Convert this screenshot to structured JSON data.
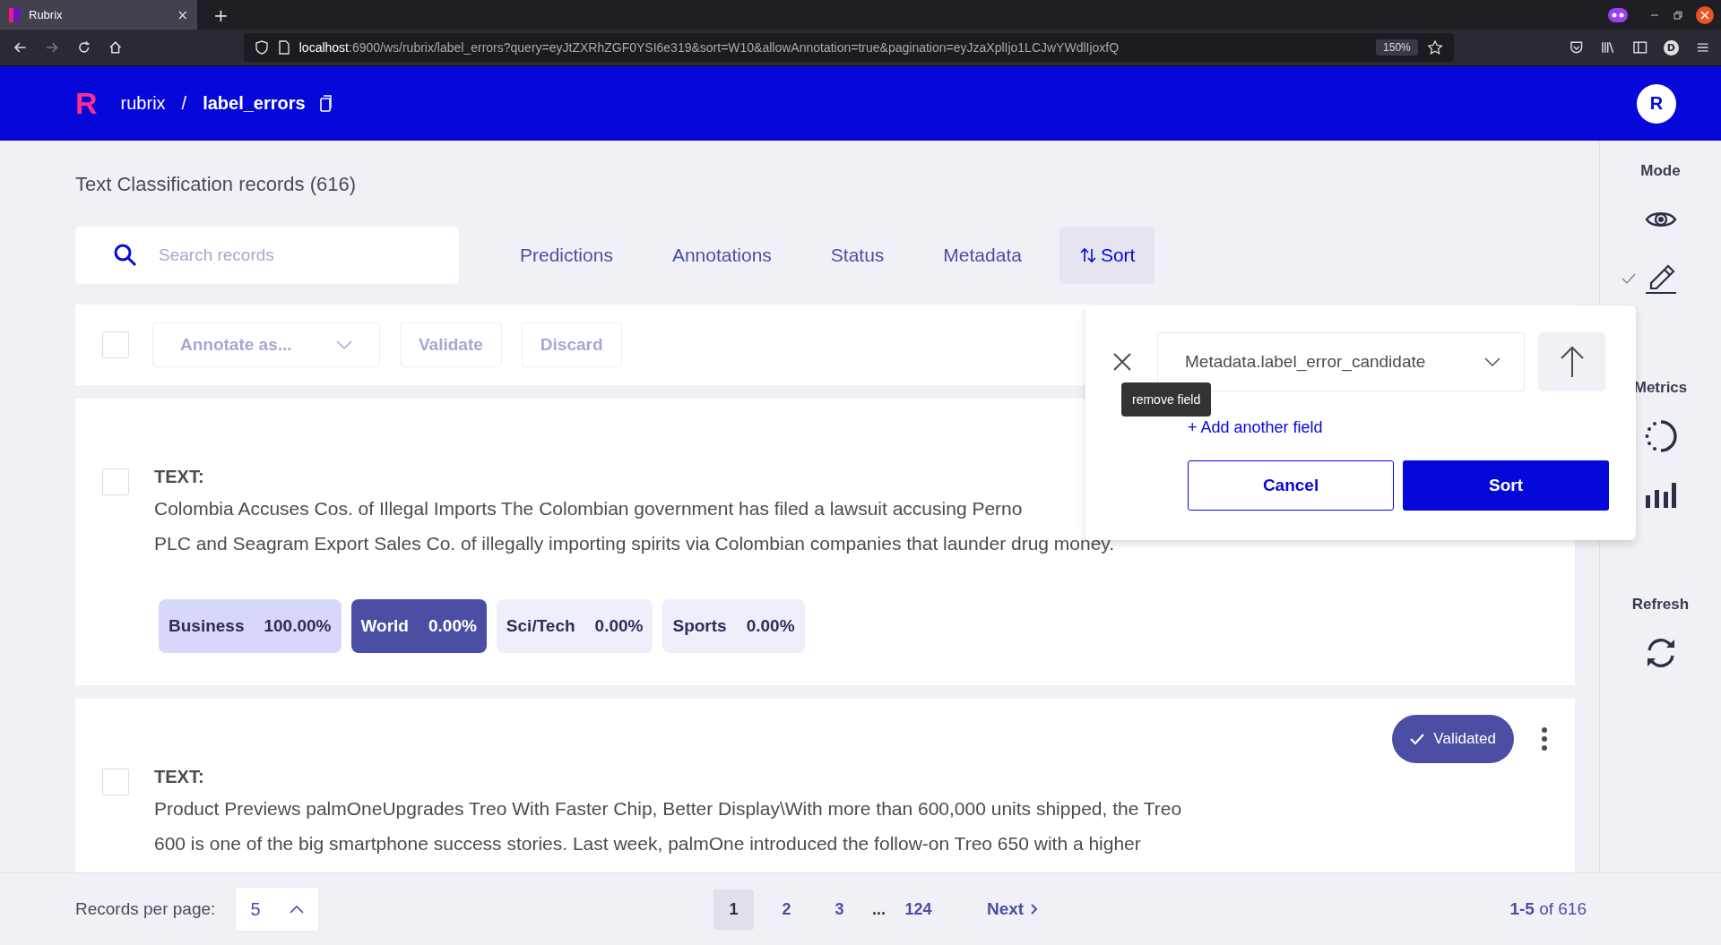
{
  "browser": {
    "tab_title": "Rubrix",
    "tab_close": "×",
    "new_tab": "+",
    "url_host": "localhost",
    "url_rest": ":6900/ws/rubrix/label_errors?query=eyJtZXRhZGF0YSI6e319&sort=W10&allowAnnotation=true&pagination=eyJzaXplIjo1LCJwYWdlIjoxfQ",
    "zoom": "150%",
    "profile": "D"
  },
  "header": {
    "logo": "R",
    "project": "rubrix",
    "separator": "/",
    "dataset": "label_errors",
    "avatar": "R"
  },
  "title": "Text Classification records (616)",
  "search": {
    "placeholder": "Search records"
  },
  "filters": [
    {
      "label": "Predictions",
      "kind": "filter",
      "selected": false
    },
    {
      "label": "Annotations",
      "kind": "filter",
      "selected": false
    },
    {
      "label": "Status",
      "kind": "filter",
      "selected": false
    },
    {
      "label": "Metadata",
      "kind": "filter",
      "selected": false
    },
    {
      "label": "Sort",
      "kind": "sort",
      "selected": true
    }
  ],
  "bulk": {
    "checked": false,
    "annotate": "Annotate as...",
    "validate": "Validate",
    "discard": "Discard"
  },
  "sort_popup": {
    "field": "Metadata.label_error_candidate",
    "tooltip": "remove field",
    "add_field": "+ Add another field",
    "cancel": "Cancel",
    "confirm": "Sort"
  },
  "records": [
    {
      "checked": false,
      "field": "TEXT:",
      "lines": [
        "Colombia Accuses Cos. of Illegal Imports The Colombian government has filed a lawsuit accusing Perno",
        "PLC and Seagram Export Sales Co. of illegally importing spirits via Colombian companies that launder drug money."
      ],
      "labels": [
        {
          "name": "Business",
          "score": "100.00%",
          "predicted": true,
          "selected": false
        },
        {
          "name": "World",
          "score": "0.00%",
          "predicted": false,
          "selected": true
        },
        {
          "name": "Sci/Tech",
          "score": "0.00%",
          "predicted": false,
          "selected": false
        },
        {
          "name": "Sports",
          "score": "0.00%",
          "predicted": false,
          "selected": false
        }
      ]
    },
    {
      "checked": false,
      "field": "TEXT:",
      "status": "Validated",
      "lines": [
        "Product Previews palmOneUpgrades Treo With Faster Chip, Better Display\\With more than 600,000 units shipped, the Treo",
        "600 is one of the big smartphone success stories. Last week, palmOne introduced the follow-on Treo 650 with a higher"
      ]
    }
  ],
  "sidebar": [
    {
      "title": "Mode",
      "items": [
        {
          "kind": "eye",
          "selected": false
        },
        {
          "kind": "pencil",
          "selected": true
        }
      ]
    },
    {
      "title": "Metrics",
      "items": [
        {
          "kind": "donut"
        },
        {
          "kind": "bars"
        }
      ]
    },
    {
      "title": "Refresh",
      "items": [
        {
          "kind": "refresh"
        }
      ]
    }
  ],
  "footer": {
    "per_page_label": "Records per page:",
    "per_page": "5",
    "pages": [
      {
        "label": "1",
        "kind": "page",
        "selected": true
      },
      {
        "label": "2",
        "kind": "page",
        "selected": false
      },
      {
        "label": "3",
        "kind": "page",
        "selected": false
      },
      {
        "label": "...",
        "kind": "gap"
      },
      {
        "label": "124",
        "kind": "page",
        "selected": false
      }
    ],
    "next": "Next",
    "range": "**1-5** of 616"
  }
}
